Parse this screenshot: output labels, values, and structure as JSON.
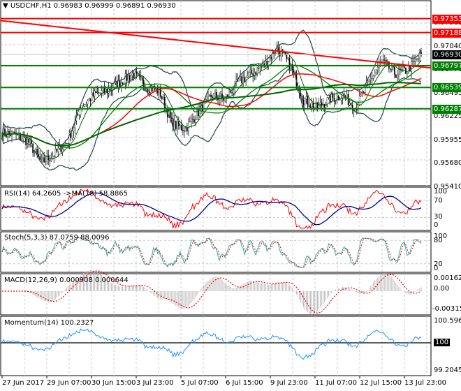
{
  "header": {
    "symbol": "USDCHF,H1",
    "ohlc": "0.96983 0.96999 0.96891 0.96930"
  },
  "price_axis": [
    "0.97315",
    "0.97040",
    "0.96770",
    "0.96495",
    "0.96225",
    "0.95955",
    "0.95680",
    "0.95410"
  ],
  "price_tags": [
    {
      "value": "0.97353",
      "color": "#ff0000"
    },
    {
      "value": "0.97188",
      "color": "#ff0000"
    },
    {
      "value": "0.96930",
      "color": "#000000"
    },
    {
      "value": "0.96797",
      "color": "#008000"
    },
    {
      "value": "0.96539",
      "color": "#008000"
    },
    {
      "value": "0.96287",
      "color": "#008000"
    }
  ],
  "indicators": {
    "rsi": {
      "label": "RSI(14) 64.2605  ->MA(18) 58.8865",
      "axis": [
        "100",
        "70",
        "30",
        "0"
      ]
    },
    "stoch": {
      "label": "Stoch(5,3,3) 87.0759 88.0096",
      "axis": [
        "100",
        "80",
        "20",
        "0"
      ]
    },
    "macd": {
      "label": "MACD(12,26,9) 0.000908 0.000644",
      "axis": [
        "0.001622",
        "0.00",
        "-0.003154"
      ]
    },
    "momentum": {
      "label": "Momentum(14) 100.2327",
      "axis": [
        "100.5966",
        "100",
        "99.2045"
      ]
    }
  },
  "time_axis": [
    "27 Jun 2017",
    "29 Jun 07:00",
    "30 Jun 15:00",
    "3 Jul 23:00",
    "5 Jul 07:00",
    "6 Jul 15:00",
    "9 Jul 23:00",
    "11 Jul 07:00",
    "12 Jul 15:00",
    "13 Jul 23:00"
  ],
  "chart_data": {
    "type": "candlestick",
    "symbol": "USDCHF",
    "timeframe": "H1",
    "ylim": [
      0.9541,
      0.9745
    ],
    "close_anchors": [
      0.96,
      0.9598,
      0.959,
      0.9565,
      0.9575,
      0.959,
      0.963,
      0.9645,
      0.965,
      0.966,
      0.967,
      0.9655,
      0.965,
      0.961,
      0.9605,
      0.9625,
      0.9645,
      0.964,
      0.966,
      0.967,
      0.968,
      0.97,
      0.968,
      0.964,
      0.963,
      0.964,
      0.9645,
      0.963,
      0.966,
      0.9685,
      0.967,
      0.9675,
      0.9693
    ],
    "horizontal_levels": [
      {
        "value": 0.97353,
        "color": "#ff0000"
      },
      {
        "value": 0.97188,
        "color": "#ff0000"
      },
      {
        "value": 0.96797,
        "color": "#008000"
      },
      {
        "value": 0.96539,
        "color": "#008000"
      },
      {
        "value": 0.96287,
        "color": "#008000"
      }
    ],
    "trendline": {
      "from": 0.9733,
      "to": 0.9677,
      "color": "#ff0000"
    },
    "rsi": {
      "value": 64.2605,
      "ma": 58.8865,
      "ylim": [
        0,
        100
      ]
    },
    "stoch": {
      "k": 87.0759,
      "d": 88.0096,
      "ylim": [
        0,
        100
      ]
    },
    "macd": {
      "main": 0.000908,
      "signal": 0.000644,
      "ylim": [
        -0.003154,
        0.001622
      ]
    },
    "momentum": {
      "value": 100.2327,
      "ylim": [
        99.2045,
        100.5966
      ]
    }
  }
}
